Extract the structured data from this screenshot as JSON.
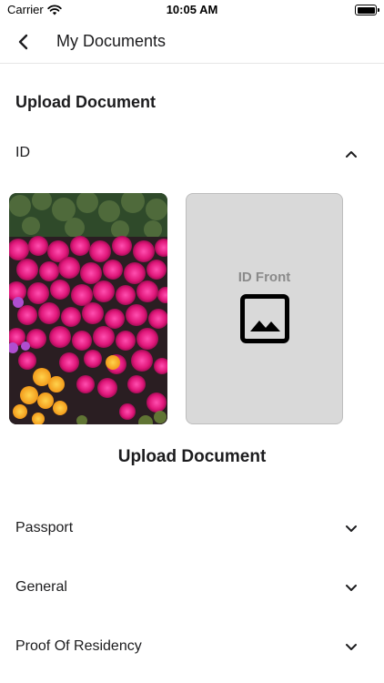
{
  "status_bar": {
    "carrier": "Carrier",
    "time": "10:05 AM",
    "wifi_icon": "wifi-icon",
    "battery_icon": "battery-icon"
  },
  "nav": {
    "back_icon": "chevron-left-icon",
    "title": "My Documents"
  },
  "section": {
    "title": "Upload Document"
  },
  "expanded_category": {
    "label": "ID",
    "chevron_icon": "chevron-up-icon",
    "uploaded_photo_icon": "photo-thumbnail",
    "placeholder": {
      "label": "ID Front",
      "icon": "image-icon"
    },
    "upload_title": "Upload Document"
  },
  "categories": [
    {
      "label": "Passport",
      "chevron_icon": "chevron-down-icon"
    },
    {
      "label": "General",
      "chevron_icon": "chevron-down-icon"
    },
    {
      "label": "Proof Of Residency",
      "chevron_icon": "chevron-down-icon"
    }
  ],
  "colors": {
    "text": "#1c1c1e",
    "placeholder_bg": "#d9d9d9",
    "placeholder_text": "#8a8a8a",
    "flower_magenta": "#e0177a",
    "flower_orange": "#f5a623"
  }
}
